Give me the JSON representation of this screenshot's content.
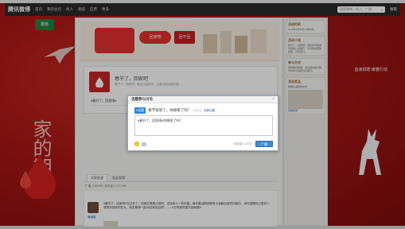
{
  "topnav": {
    "logo": "腾讯微博",
    "items": [
      "首页",
      "我的主页",
      "找人",
      "频道",
      "应用",
      "更多"
    ],
    "search_placeholder": "搜索微博、找人、广播",
    "user": "春雨"
  },
  "left_deco": {
    "brand": "春雨",
    "calligraphy": "家的期盼"
  },
  "right_deco": {
    "brand": "血液捐赠·暖春行动"
  },
  "banner": {
    "pill_text": "回家吧",
    "pill2_text": "回不回"
  },
  "profile": {
    "title": "春节了，回家吧",
    "subtitle": "春节了，回家吧！献血公益相伴，让爱流动回家的路。",
    "tag": "#春节了，回家吧#"
  },
  "feed": {
    "tabs": [
      "大家在说",
      "相关视频"
    ],
    "stats": "广播 1783095  |  收听量 1,727,995",
    "post_user": "暖暖春",
    "post_text": "#春节了，回家吧#在过年了，回家去看看父母吧，送给家人一份祝福。每年春运期间都有大量献血者坚持献血，这份温暖也让更多人感受到回家的意义。转发微博一起为回家加油吧！——#分享我的春节回家路#"
  },
  "side": {
    "boxes": [
      {
        "title": "活动时间",
        "text": "2013年1月18日-2月28日"
      },
      {
        "title": "活动介绍",
        "text": "春节了，回家吧！围绕春节回家与献血公益展开，分享你的回家故事，为爱接力。"
      },
      {
        "title": "参与方式",
        "text": "登录腾讯微博，关注活动官方账号并参与话题讨论即可。"
      },
      {
        "title": "活动奖品",
        "text": "精美礼品等你来拿"
      }
    ],
    "more_link": "查看更多"
  },
  "dialog": {
    "title": "话题参与讨论",
    "close": "×",
    "topic_tag": "#话题",
    "question": "春节快到了，你想家了吗？",
    "count": "(1172)",
    "link": "查看话题",
    "content": "#春节了，回家吧#你想家了吗？",
    "char_count": "还能输入120字",
    "send": "广播"
  },
  "colors": {
    "background": "#a41414",
    "nav": "#2a2a2a",
    "accent_blue": "#3b8bd8",
    "brand_green": "#0f8b3e"
  }
}
